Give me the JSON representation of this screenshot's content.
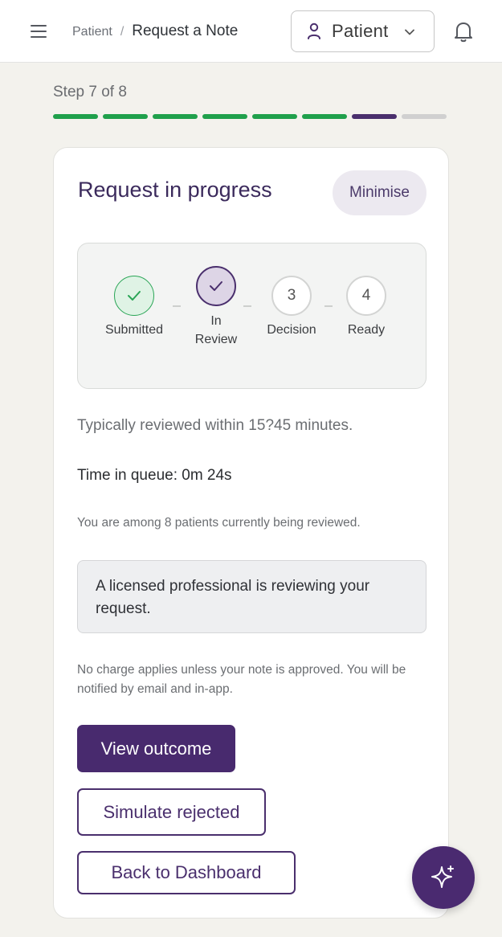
{
  "header": {
    "breadcrumb_root": "Patient",
    "breadcrumb_sep": "/",
    "breadcrumb_current": "Request a Note",
    "role_select_value": "Patient"
  },
  "progress": {
    "label": "Step 7 of 8",
    "current_step": 7,
    "total_steps": 8,
    "complete_color": "#1fa04b",
    "current_color": "#4a2f6d",
    "pending_color": "#d0d0d0"
  },
  "card": {
    "title": "Request in progress",
    "minimise_label": "Minimise",
    "stages": [
      {
        "label": "Submitted",
        "state": "complete",
        "marker": "check"
      },
      {
        "label": "In\nReview",
        "state": "current",
        "marker": "check"
      },
      {
        "label": "Decision",
        "state": "pending",
        "marker": "3"
      },
      {
        "label": "Ready",
        "state": "pending",
        "marker": "4"
      }
    ],
    "typical_time": "Typically reviewed within 15?45 minutes.",
    "queue_time": "Time in queue: 0m 24s",
    "queue_count": "You are among 8 patients currently being reviewed.",
    "review_message": "A licensed professional is reviewing your request.",
    "charge_note": "No charge applies unless your note is approved. You will be notified by email and in-app.",
    "view_outcome_label": "View outcome",
    "simulate_rejected_label": "Simulate rejected",
    "back_label": "Back to Dashboard"
  },
  "fab": {
    "icon": "sparkle-icon"
  }
}
